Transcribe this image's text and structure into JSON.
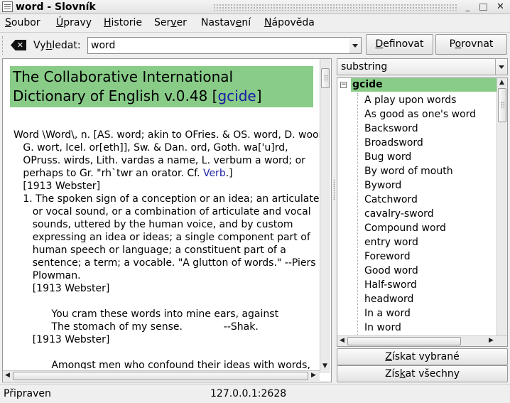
{
  "window": {
    "title": "word - Slovník",
    "controls": {
      "minimize": "_",
      "maximize": "",
      "close": "✕"
    }
  },
  "menubar": {
    "items": [
      {
        "pre": "",
        "key": "S",
        "post": "oubor"
      },
      {
        "pre": "",
        "key": "Ú",
        "post": "pravy"
      },
      {
        "pre": "",
        "key": "H",
        "post": "istorie"
      },
      {
        "pre": "Ser",
        "key": "v",
        "post": "er"
      },
      {
        "pre": "Nastav",
        "key": "e",
        "post": "ní"
      },
      {
        "pre": "",
        "key": "N",
        "post": "ápověda"
      }
    ]
  },
  "toolbar": {
    "clear_icon": "clear-entry-icon",
    "search_label_pre": "Vy",
    "search_label_key": "h",
    "search_label_post": "ledat:",
    "search_value": "word",
    "define_pre": "",
    "define_key": "D",
    "define_post": "efinovat",
    "compare_pre": "P",
    "compare_key": "o",
    "compare_post": "rovnat"
  },
  "definition": {
    "header_text": "The Collaborative International\nDictionary of English v.0.48 [",
    "header_link": "gcide",
    "header_end": "]",
    "body_1": "Word \\Word\\, n. [AS. word; akin to OFries. & OS. word, D. woord,\n   G. wort, Icel. or[eth]], Sw. & Dan. ord, Goth. wa['u]rd,\n   OPruss. wirds, Lith. vardas a name, L. verbum a word; or\n   perhaps to Gr. \"rh`twr an orator. Cf. ",
    "body_link": "Verb",
    "body_2": ".]\n   [1913 Webster]\n   1. The spoken sign of a conception or an idea; an articulate\n      or vocal sound, or a combination of articulate and vocal\n      sounds, uttered by the human voice, and by custom\n      expressing an idea or ideas; a single component part of\n      human speech or language; a constituent part of a\n      sentence; a term; a vocable. \"A glutton of words.\" --Piers\n      Plowman.\n      [1913 Webster]\n\n            You cram these words into mine ears, against\n            The stomach of my sense.             --Shak.\n      [1913 Webster]\n\n            Amongst men who confound their ideas with words,"
  },
  "sidebar": {
    "strategy": "substring",
    "database": "gcide",
    "matches": [
      "A play upon words",
      "As good as one's word",
      "Backsword",
      "Broadsword",
      "Bug word",
      "By word of mouth",
      "Byword",
      "Catchword",
      "cavalry-sword",
      "Compound word",
      "entry word",
      "Foreword",
      "Good word",
      "Half-sword",
      "headword",
      "In a word",
      "In word"
    ],
    "get_selected_pre": "",
    "get_selected_key": "Z",
    "get_selected_post": "ískat vybrané",
    "get_all_pre": "Zís",
    "get_all_key": "k",
    "get_all_post": "at všechny"
  },
  "status": {
    "text": "Připraven",
    "server": "127.0.0.1:2628"
  }
}
